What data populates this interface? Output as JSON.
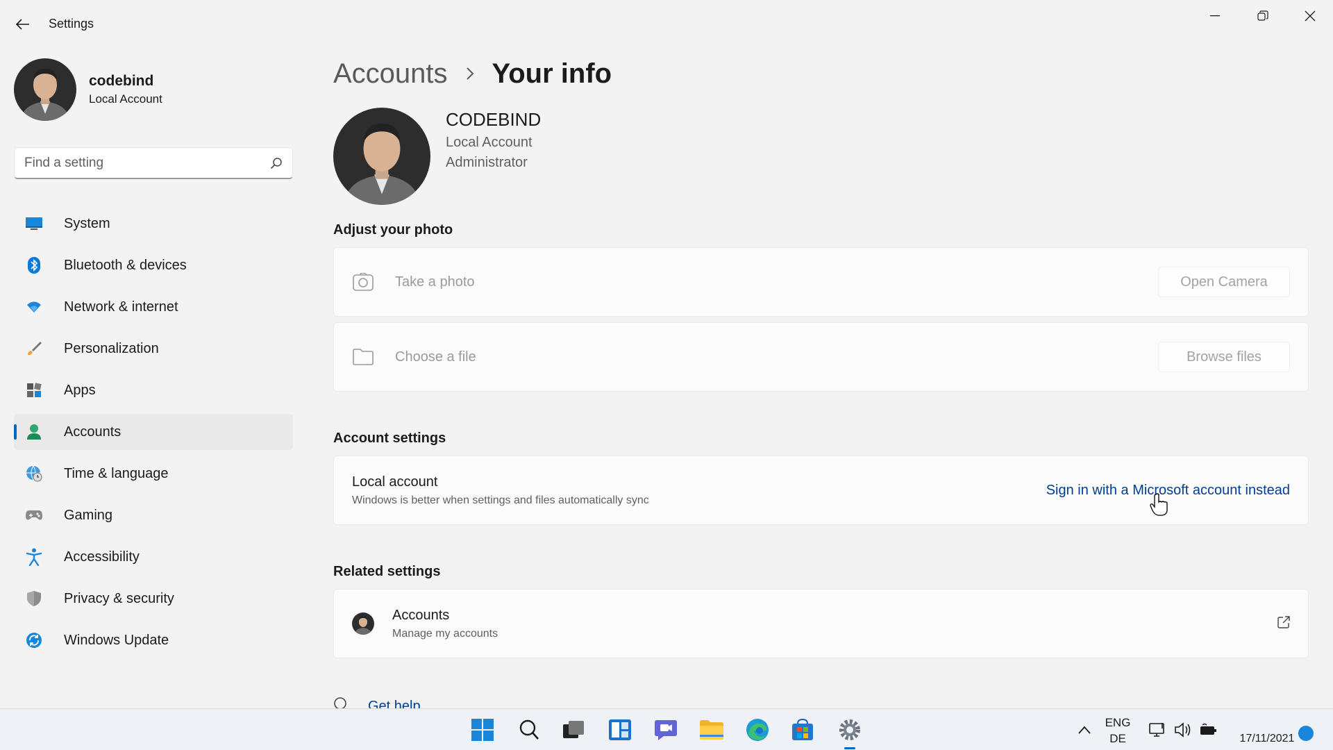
{
  "window": {
    "title": "Settings"
  },
  "sidebar": {
    "profile": {
      "name": "codebind",
      "account_type": "Local Account"
    },
    "search": {
      "placeholder": "Find a setting"
    },
    "items": [
      {
        "label": "System",
        "icon": "monitor-icon"
      },
      {
        "label": "Bluetooth & devices",
        "icon": "bluetooth-icon"
      },
      {
        "label": "Network & internet",
        "icon": "wifi-icon"
      },
      {
        "label": "Personalization",
        "icon": "brush-icon"
      },
      {
        "label": "Apps",
        "icon": "apps-icon"
      },
      {
        "label": "Accounts",
        "icon": "person-icon",
        "active": true
      },
      {
        "label": "Time & language",
        "icon": "globe-clock-icon"
      },
      {
        "label": "Gaming",
        "icon": "gamepad-icon"
      },
      {
        "label": "Accessibility",
        "icon": "accessibility-icon"
      },
      {
        "label": "Privacy & security",
        "icon": "shield-icon"
      },
      {
        "label": "Windows Update",
        "icon": "update-icon"
      }
    ]
  },
  "main": {
    "breadcrumb": {
      "parent": "Accounts",
      "current": "Your info"
    },
    "user": {
      "name": "CODEBIND",
      "type": "Local Account",
      "role": "Administrator"
    },
    "adjust_photo": {
      "title": "Adjust your photo",
      "take_photo": {
        "label": "Take a photo",
        "button": "Open Camera"
      },
      "choose_file": {
        "label": "Choose a file",
        "button": "Browse files"
      }
    },
    "account_settings": {
      "title": "Account settings",
      "local": {
        "title": "Local account",
        "subtitle": "Windows is better when settings and files automatically sync",
        "link": "Sign in with a Microsoft account instead"
      }
    },
    "related": {
      "title": "Related settings",
      "accounts": {
        "title": "Accounts",
        "subtitle": "Manage my accounts"
      }
    },
    "get_help": "Get help"
  },
  "taskbar": {
    "language": "ENG",
    "layout": "DE",
    "date": "17/11/2021"
  },
  "colors": {
    "accent": "#0067c0",
    "link": "#003e92"
  }
}
